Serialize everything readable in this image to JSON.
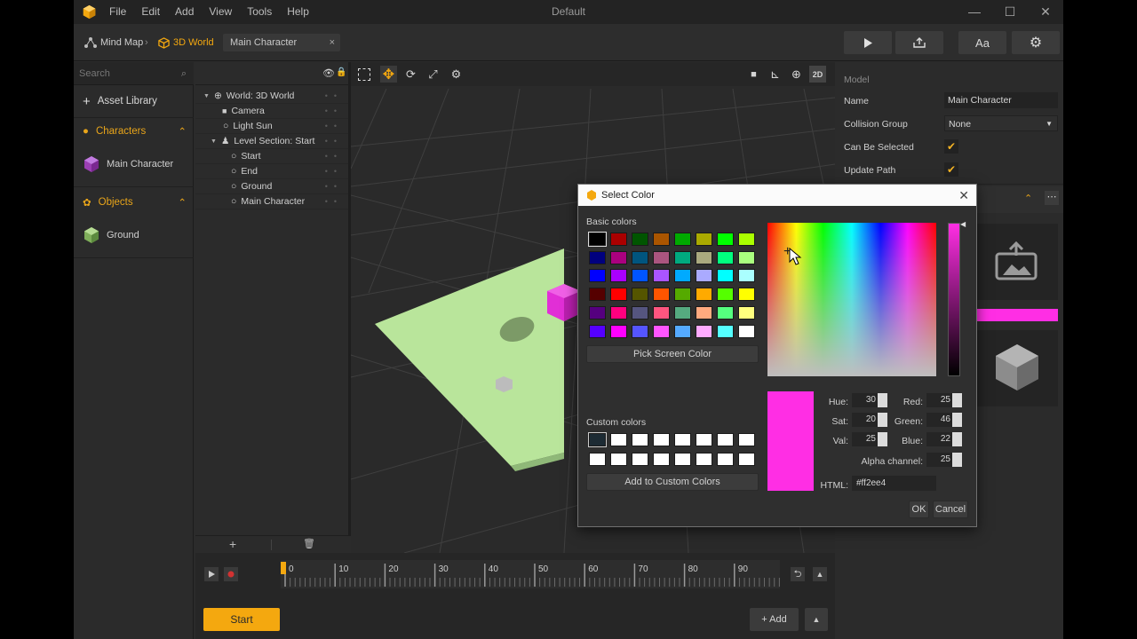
{
  "colors": {
    "accent": "#f4a80f",
    "selected_color": "#ff2ee4",
    "plane": "#b9e59b"
  },
  "titlebar": {
    "menu": [
      "File",
      "Edit",
      "Add",
      "View",
      "Tools",
      "Help"
    ],
    "title": "Default",
    "window_buttons": [
      "—",
      "☐",
      "✕"
    ]
  },
  "toolbar": {
    "breadcrumbs": [
      "Mind Map",
      "3D World"
    ],
    "doc_tab": "Main Character",
    "right_buttons": [
      "play-icon",
      "share-icon",
      "Aa",
      "gear-icon"
    ],
    "font_button_label": "Aa"
  },
  "left_panel": {
    "search_placeholder": "Search",
    "asset_library": "Asset Library",
    "sections": [
      {
        "title": "Characters",
        "items": [
          "Main Character"
        ]
      },
      {
        "title": "Objects",
        "items": [
          "Ground"
        ]
      }
    ]
  },
  "outliner": {
    "rows": [
      {
        "label": "World: 3D World",
        "icon": "globe-icon"
      },
      {
        "label": "Camera",
        "icon": "camera-icon"
      },
      {
        "label": "Light Sun",
        "icon": "light-icon"
      },
      {
        "label": "Level Section: Start",
        "icon": "person-icon"
      },
      {
        "label": "Start",
        "icon": "node-icon"
      },
      {
        "label": "End",
        "icon": "node-icon"
      },
      {
        "label": "Ground",
        "icon": "node-icon"
      },
      {
        "label": "Main Character",
        "icon": "node-icon"
      }
    ],
    "footer": {
      "add": "+",
      "delete": "🗑"
    }
  },
  "viewport": {
    "mode_label": "2D"
  },
  "properties": {
    "section": "Model",
    "rows": [
      {
        "label": "Name",
        "value": "Main Character"
      },
      {
        "label": "Collision Group",
        "value": "None"
      },
      {
        "label": "Can Be Selected",
        "value": "✔"
      },
      {
        "label": "Update Path",
        "value": "✔"
      }
    ]
  },
  "timeline": {
    "ticks": [
      "0",
      "10",
      "20",
      "30",
      "40",
      "50",
      "60",
      "70",
      "80",
      "90"
    ],
    "start_button": "Start",
    "add_button": "Add"
  },
  "dialog": {
    "title": "Select Color",
    "basic_colors_label": "Basic colors",
    "custom_colors_label": "Custom colors",
    "pick_screen": "Pick Screen Color",
    "add_custom": "Add to Custom Colors",
    "fields": {
      "hue_label": "Hue:",
      "hue": "30",
      "sat_label": "Sat:",
      "sat": "20",
      "val_label": "Val:",
      "val": "25",
      "red_label": "Red:",
      "red": "25",
      "green_label": "Green:",
      "green": "46",
      "blue_label": "Blue:",
      "blue": "22",
      "alpha_label": "Alpha channel:",
      "alpha": "25",
      "html_label": "HTML:",
      "html": "#ff2ee4"
    },
    "ok": "OK",
    "cancel": "Cancel",
    "basic_colors": [
      "#000000",
      "#aa0000",
      "#005500",
      "#aa5500",
      "#00aa00",
      "#aaaa00",
      "#00ff00",
      "#aaff00",
      "#00007f",
      "#aa007f",
      "#00557f",
      "#aa557f",
      "#00aa7f",
      "#aaaa7f",
      "#00ff7f",
      "#aaff7f",
      "#0000ff",
      "#aa00ff",
      "#0055ff",
      "#aa55ff",
      "#00aaff",
      "#aaaaff",
      "#00ffff",
      "#aaffff",
      "#550000",
      "#ff0000",
      "#555500",
      "#ff5500",
      "#55aa00",
      "#ffaa00",
      "#55ff00",
      "#ffff00",
      "#55007f",
      "#ff007f",
      "#55557f",
      "#ff557f",
      "#55aa7f",
      "#ffaa7f",
      "#55ff7f",
      "#ffff7f",
      "#5500ff",
      "#ff00ff",
      "#5555ff",
      "#ff55ff",
      "#55aaff",
      "#ffaaff",
      "#55ffff",
      "#ffffff"
    ]
  }
}
